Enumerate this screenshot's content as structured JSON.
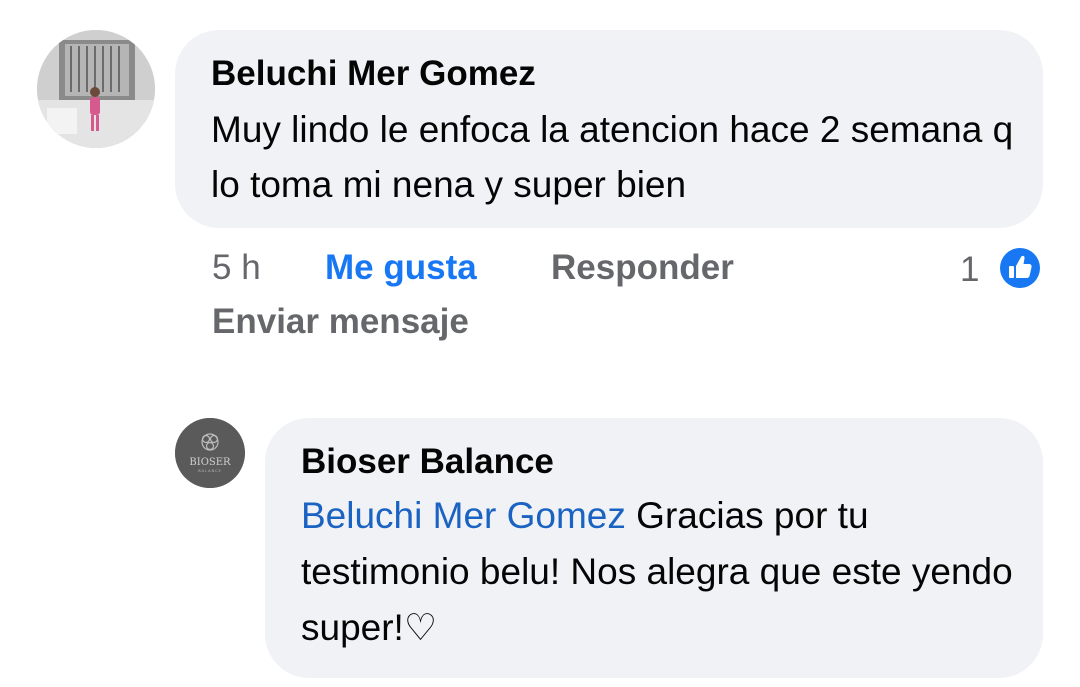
{
  "comment": {
    "author": "Beluchi Mer Gomez",
    "text": "Muy lindo le enfoca la atencion hace 2 semana q lo toma mi nena y super bien",
    "time": "5 h",
    "like_label": "Me gusta",
    "reply_label": "Responder",
    "message_label": "Enviar mensaje",
    "reaction_count": "1",
    "reaction_icon": "like-icon"
  },
  "reply": {
    "author": "Bioser Balance",
    "mention": "Beluchi Mer Gomez",
    "text": " Gracias por tu testimonio belu! Nos alegra que este yendo super!♡",
    "avatar_logo": "BIOSER",
    "avatar_logo_sub": "BALANCE"
  },
  "colors": {
    "bubble_bg": "#f0f2f5",
    "link_blue": "#1877f2",
    "mention_blue": "#1b63c2",
    "muted_gray": "#65676b"
  }
}
